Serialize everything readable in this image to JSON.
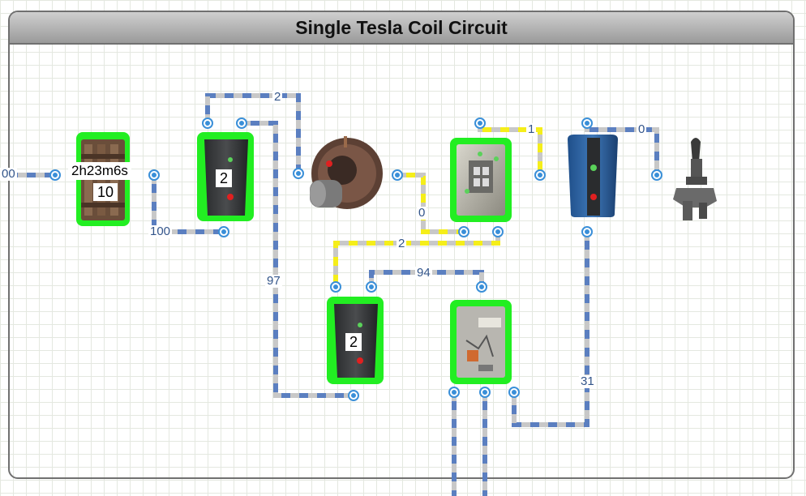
{
  "title": "Single Tesla Coil Circuit",
  "timer": {
    "time_label": "2h23m6s",
    "value_label": "10"
  },
  "left_input_label": "00",
  "counters": {
    "first_value": "2",
    "second_value": "2"
  },
  "wire_labels": {
    "top": "2",
    "timer_output": "100",
    "long_vertical": "97",
    "yellow_switch": "0",
    "yellow_to_counter": "2",
    "yellow_top": "1",
    "battery_top": "0",
    "to_panel": "94",
    "battery_down": "31"
  },
  "colors": {
    "wire_blue": "#5b7fc0",
    "wire_grey": "#c8c8c8",
    "wire_yellow": "#f5ee1a",
    "highlight": "#22ee22",
    "port": "#3a8fd8"
  },
  "devices": [
    {
      "type": "timer-relay-icon"
    },
    {
      "type": "counter-icon"
    },
    {
      "type": "electric-switch-icon"
    },
    {
      "type": "and-switch-icon"
    },
    {
      "type": "battery-icon"
    },
    {
      "type": "tesla-coil-icon"
    },
    {
      "type": "counter-icon"
    },
    {
      "type": "power-panel-icon"
    }
  ]
}
